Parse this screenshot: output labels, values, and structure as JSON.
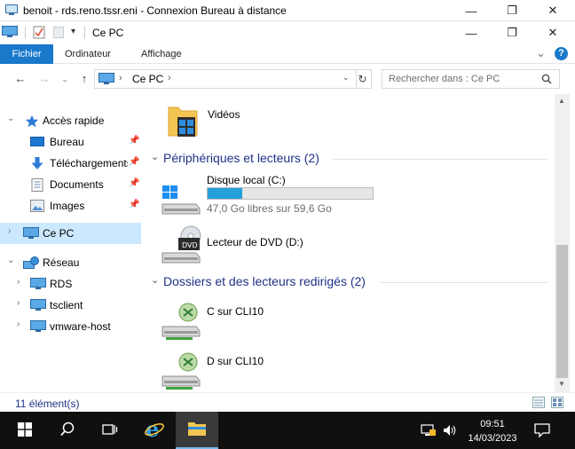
{
  "rdp_window": {
    "title": "benoit - rds.reno.tssr.eni - Connexion Bureau à distance",
    "minimize_glyph": "—",
    "restore_glyph": "❐",
    "close_glyph": "✕"
  },
  "explorer_window": {
    "title": "Ce PC",
    "minimize_glyph": "—",
    "restore_glyph": "❐",
    "close_glyph": "✕"
  },
  "ribbon": {
    "tabs": [
      {
        "label": "Fichier"
      },
      {
        "label": "Ordinateur"
      },
      {
        "label": "Affichage"
      }
    ],
    "help_glyph": "?",
    "expand_glyph": "⌄"
  },
  "address_bar": {
    "path": [
      "Ce PC"
    ],
    "search_placeholder": "Rechercher dans : Ce PC"
  },
  "nav_pane": {
    "quick_access": {
      "label": "Accès rapide",
      "items": [
        {
          "label": "Bureau",
          "icon": "desktop-icon"
        },
        {
          "label": "Téléchargements",
          "icon": "download-icon"
        },
        {
          "label": "Documents",
          "icon": "documents-icon"
        },
        {
          "label": "Images",
          "icon": "images-icon"
        }
      ]
    },
    "this_pc": {
      "label": "Ce PC"
    },
    "network": {
      "label": "Réseau",
      "items": [
        {
          "label": "RDS"
        },
        {
          "label": "tsclient"
        },
        {
          "label": "vmware-host"
        }
      ]
    }
  },
  "content": {
    "folders": [
      {
        "label": "Vidéos",
        "icon": "videos-folder-icon"
      }
    ],
    "devices_group": {
      "title": "Périphériques et lecteurs (2)",
      "items": [
        {
          "label": "Disque local (C:)",
          "free_text": "47,0 Go libres sur 59,6 Go",
          "used_fraction": 0.212
        },
        {
          "label": "Lecteur de DVD (D:)"
        }
      ]
    },
    "redirected_group": {
      "title": "Dossiers et des lecteurs redirigés (2)",
      "items": [
        {
          "label": "C sur CLI10"
        },
        {
          "label": "D sur CLI10"
        }
      ]
    }
  },
  "status_bar": {
    "item_count": "11 élément(s)"
  },
  "taskbar": {
    "time": "09:51",
    "date": "14/03/2023"
  },
  "colors": {
    "accent": "#1979ca",
    "group_header": "#1e3287",
    "selection": "#cce8ff",
    "progress": "#26a0da",
    "taskbar": "#101010"
  }
}
